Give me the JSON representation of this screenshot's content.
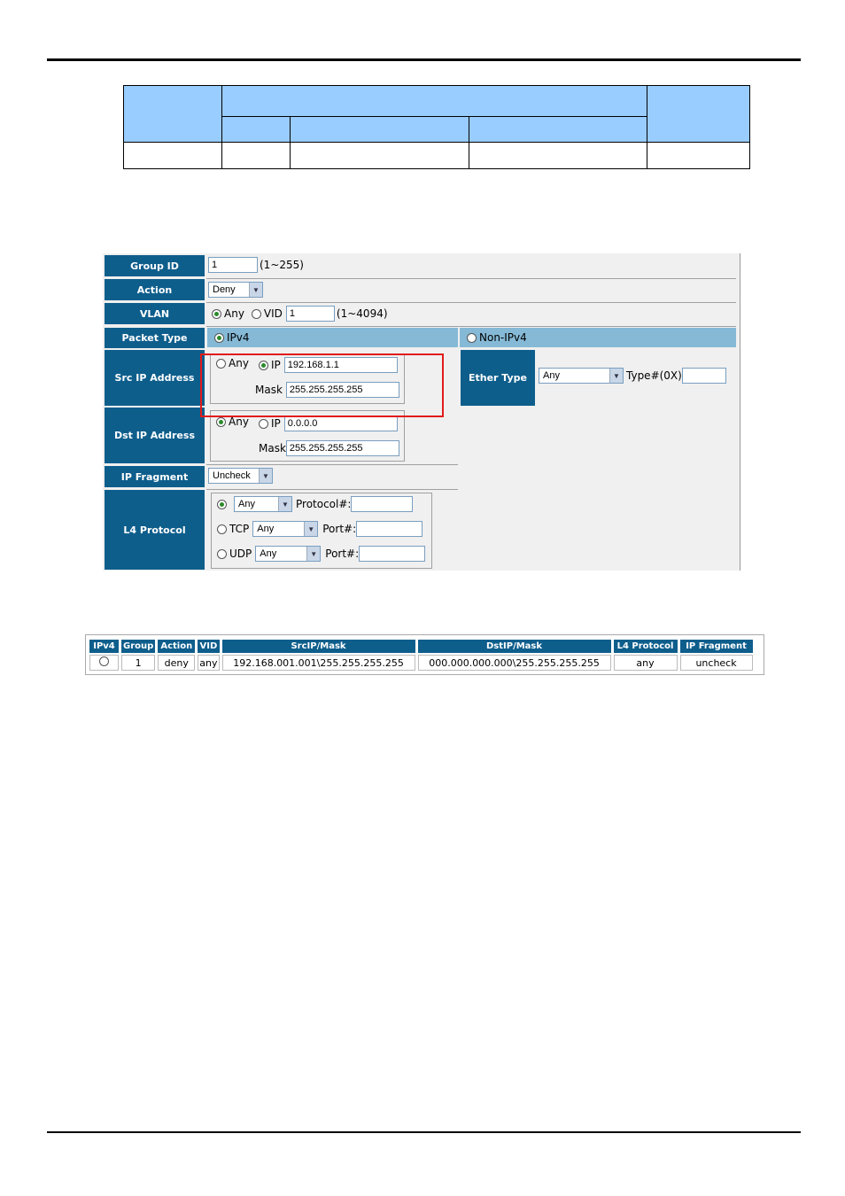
{
  "form": {
    "group_id": {
      "label": "Group ID",
      "value": "1",
      "hint": "(1~255)"
    },
    "action": {
      "label": "Action",
      "selected": "Deny"
    },
    "vlan": {
      "label": "VLAN",
      "any_label": "Any",
      "vid_label": "VID",
      "vid_value": "1",
      "hint": "(1~4094)",
      "selected": "Any"
    },
    "packet_type": {
      "label": "Packet Type",
      "ipv4_label": "IPv4",
      "non_ipv4_label": "Non-IPv4",
      "selected": "IPv4"
    },
    "src_ip": {
      "label": "Src IP Address",
      "any_label": "Any",
      "ip_label": "IP",
      "ip_value": "192.168.1.1",
      "mask_label": "Mask",
      "mask_value": "255.255.255.255",
      "selected": "IP"
    },
    "dst_ip": {
      "label": "Dst IP Address",
      "any_label": "Any",
      "ip_label": "IP",
      "ip_value": "0.0.0.0",
      "mask_label": "Mask",
      "mask_value": "255.255.255.255",
      "selected": "Any"
    },
    "ip_fragment": {
      "label": "IP Fragment",
      "selected": "Uncheck"
    },
    "l4_protocol": {
      "label": "L4 Protocol",
      "selected": "protocol",
      "protocol": {
        "selected": "Any",
        "field_label": "Protocol#:",
        "value": ""
      },
      "tcp": {
        "label": "TCP",
        "selected": "Any",
        "field_label": "Port#:",
        "value": ""
      },
      "udp": {
        "label": "UDP",
        "selected": "Any",
        "field_label": "Port#:",
        "value": ""
      }
    },
    "ether_type": {
      "label": "Ether Type",
      "selected": "Any",
      "field_label": "Type#(0X)",
      "value": ""
    }
  },
  "result_table": {
    "headers": [
      "IPv4",
      "Group",
      "Action",
      "VID",
      "SrcIP/Mask",
      "DstIP/Mask",
      "L4 Protocol",
      "IP Fragment"
    ],
    "rows": [
      {
        "group": "1",
        "action": "deny",
        "vid": "any",
        "src": "192.168.001.001\\255.255.255.255",
        "dst": "000.000.000.000\\255.255.255.255",
        "l4": "any",
        "frag": "uncheck"
      }
    ]
  },
  "colors": {
    "label_bg": "#0e5e8c",
    "band_bg": "#85b9d6",
    "doc_header_bg": "#99ccff",
    "highlight": "#e21b1b"
  }
}
